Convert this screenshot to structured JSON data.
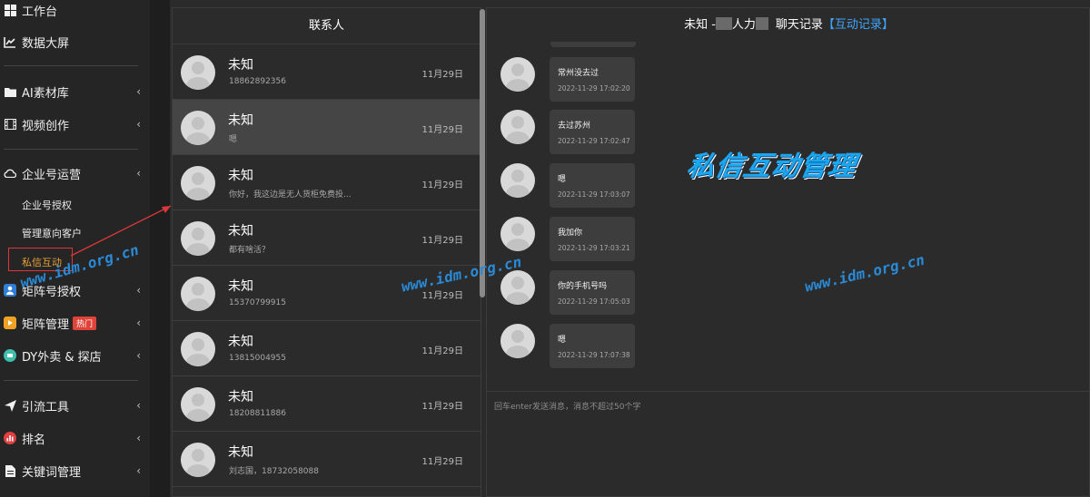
{
  "sidebar": {
    "items": [
      {
        "label": "工作台"
      },
      {
        "label": "数据大屏"
      },
      {
        "label": "AI素材库"
      },
      {
        "label": "视频创作"
      },
      {
        "label": "企业号运营"
      },
      {
        "label": "矩阵号授权"
      },
      {
        "label": "矩阵管理",
        "badge": "热门"
      },
      {
        "label": "DY外卖 & 探店"
      },
      {
        "label": "引流工具"
      },
      {
        "label": "排名"
      },
      {
        "label": "关键词管理"
      }
    ],
    "sub_items": [
      {
        "label": "企业号授权"
      },
      {
        "label": "管理意向客户"
      },
      {
        "label": "私信互动"
      }
    ]
  },
  "contacts": {
    "header": "联系人",
    "list": [
      {
        "name": "未知",
        "message": "18862892356",
        "date": "11月29日"
      },
      {
        "name": "未知",
        "message": "嗯",
        "date": "11月29日"
      },
      {
        "name": "未知",
        "message": "你好，我这边是无人货柜免费投...",
        "date": "11月29日"
      },
      {
        "name": "未知",
        "message": "都有啥活？",
        "date": "11月29日"
      },
      {
        "name": "未知",
        "message": "15370799915",
        "date": "11月29日"
      },
      {
        "name": "未知",
        "message": "13815004955",
        "date": "11月29日"
      },
      {
        "name": "未知",
        "message": "18208811886",
        "date": "11月29日"
      },
      {
        "name": "未知",
        "message": "刘志国，18732058088",
        "date": "11月29日"
      }
    ]
  },
  "chat": {
    "header_name": "未知 -",
    "header_middle": "人力",
    "header_suffix": "聊天记录",
    "header_link": "【互动记录】",
    "messages": [
      {
        "text": "常州没去过",
        "time": "2022-11-29 17:02:20"
      },
      {
        "text": "去过苏州",
        "time": "2022-11-29 17:02:47"
      },
      {
        "text": "嗯",
        "time": "2022-11-29 17:03:07"
      },
      {
        "text": "我加你",
        "time": "2022-11-29 17:03:21"
      },
      {
        "text": "你的手机号吗",
        "time": "2022-11-29 17:05:03"
      },
      {
        "text": "嗯",
        "time": "2022-11-29 17:07:38"
      }
    ],
    "input_placeholder": "回车enter发送消息，消息不超过50个字"
  },
  "overlay": {
    "title": "私信互动管理",
    "watermark": "www.idm.org.cn"
  },
  "colors": {
    "accent_link": "#3fa6ff",
    "active_sub": "#e8a13a",
    "highlight_box": "#d9373a",
    "hot_badge": "#e0433a",
    "title_blue": "#1aa7f0"
  }
}
